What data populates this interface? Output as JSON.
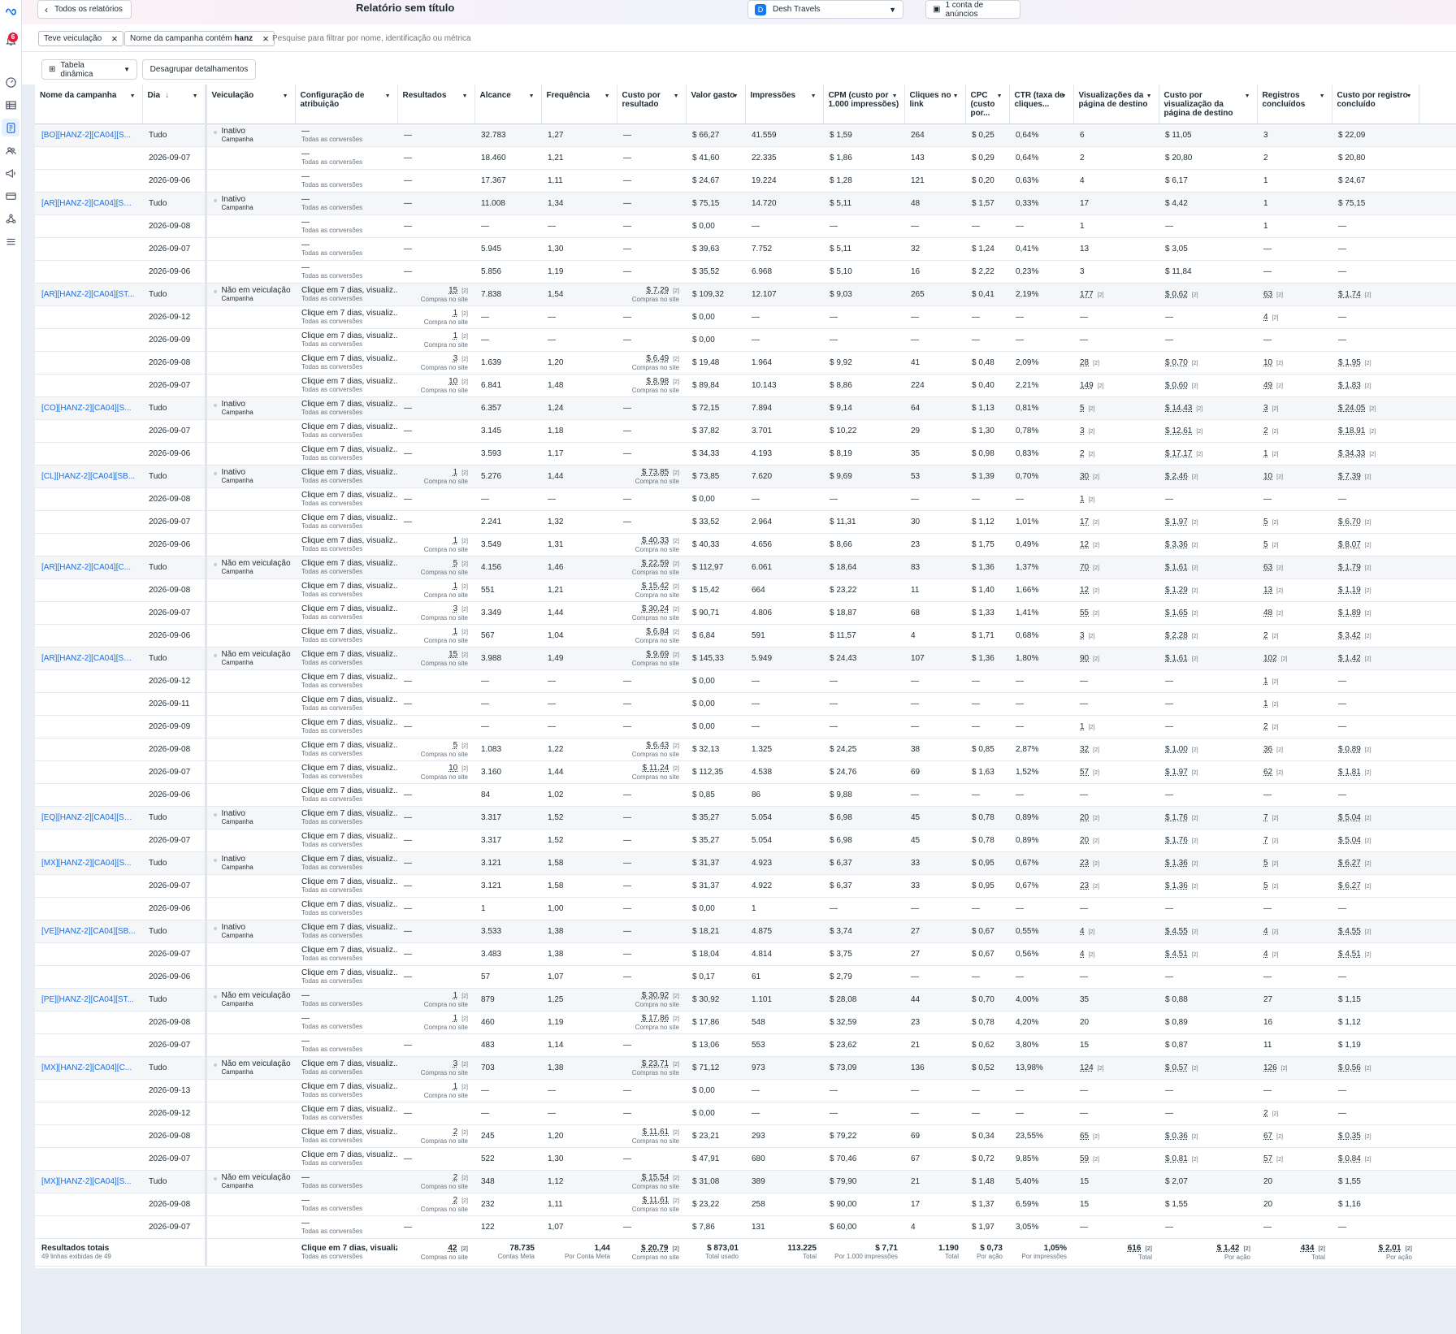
{
  "header": {
    "back_label": "Todos os relatórios",
    "title": "Relatório sem título",
    "account_initial": "D",
    "account_name": "Desh Travels",
    "ad_accounts": "1 conta de anúncios"
  },
  "notifications": {
    "count": "6"
  },
  "filters": {
    "chips": [
      "Teve veiculação",
      "Nome da campanha contém hanz"
    ],
    "placeholder": "Pesquise para filtrar por nome, identificação ou métrica"
  },
  "toolbar": {
    "pivot_label": "Tabela dinâmica",
    "ungroup_label": "Desagrupar detalhamentos"
  },
  "table": {
    "columns": [
      "Nome da campanha",
      "Dia",
      "Veiculação",
      "Configuração de atribuição",
      "Resultados",
      "Alcance",
      "Frequência",
      "Custo por resultado",
      "Valor gasto",
      "Impressões",
      "CPM (custo por 1.000 impressões)",
      "Cliques no link",
      "CPC (custo por...",
      "CTR (taxa de cliques...",
      "Visualizações da página de destino",
      "Custo por visualização da página de destino",
      "Registros concluídos",
      "Custo por registro concluído"
    ],
    "rows": [
      [
        "[BO][HANZ-2][CA04][S...",
        "Tudo",
        "Inativo|Campanha",
        "—|Todas as conversões",
        "—",
        "32.783",
        "1,27",
        "—",
        "$ 66,27",
        "41.559",
        "$ 1,59",
        "264",
        "$ 0,25",
        "0,64%",
        "6",
        "$ 11,05",
        "3",
        "$ 22,09"
      ],
      [
        "",
        "2026-09-07",
        "",
        "—|Todas as conversões",
        "—",
        "18.460",
        "1,21",
        "—",
        "$ 41,60",
        "22.335",
        "$ 1,86",
        "143",
        "$ 0,29",
        "0,64%",
        "2",
        "$ 20,80",
        "2",
        "$ 20,80"
      ],
      [
        "",
        "2026-09-06",
        "",
        "—|Todas as conversões",
        "—",
        "17.367",
        "1,11",
        "—",
        "$ 24,67",
        "19.224",
        "$ 1,28",
        "121",
        "$ 0,20",
        "0,63%",
        "4",
        "$ 6,17",
        "1",
        "$ 24,67"
      ],
      [
        "[AR][HANZ-2][CA04][SB...",
        "Tudo",
        "Inativo|Campanha",
        "—|Todas as conversões",
        "—",
        "11.008",
        "1,34",
        "—",
        "$ 75,15",
        "14.720",
        "$ 5,11",
        "48",
        "$ 1,57",
        "0,33%",
        "17",
        "$ 4,42",
        "1",
        "$ 75,15"
      ],
      [
        "",
        "2026-09-08",
        "",
        "—|Todas as conversões",
        "—",
        "—",
        "—",
        "—",
        "$ 0,00",
        "—",
        "—",
        "—",
        "—",
        "—",
        "1",
        "—",
        "1",
        "—"
      ],
      [
        "",
        "2026-09-07",
        "",
        "—|Todas as conversões",
        "—",
        "5.945",
        "1,30",
        "—",
        "$ 39,63",
        "7.752",
        "$ 5,11",
        "32",
        "$ 1,24",
        "0,41%",
        "13",
        "$ 3,05",
        "—",
        "—"
      ],
      [
        "",
        "2026-09-06",
        "",
        "—|Todas as conversões",
        "—",
        "5.856",
        "1,19",
        "—",
        "$ 35,52",
        "6.968",
        "$ 5,10",
        "16",
        "$ 2,22",
        "0,23%",
        "3",
        "$ 11,84",
        "—",
        "—"
      ],
      [
        "[AR][HANZ-2][CA04][ST...",
        "Tudo",
        "Não em veiculação|Campanha",
        "Clique em 7 dias, visualiz...|Todas as conversões",
        "15|Compras no site",
        "7.838",
        "1,54",
        "$ 7,29|Compras no site",
        "$ 109,32",
        "12.107",
        "$ 9,03",
        "265",
        "$ 0,41",
        "2,19%",
        "177",
        "$ 0,62",
        "63",
        "$ 1,74"
      ],
      [
        "",
        "2026-09-12",
        "",
        "Clique em 7 dias, visualiz...|Todas as conversões",
        "1|Compra no site",
        "—",
        "—",
        "—",
        "$ 0,00",
        "—",
        "—",
        "—",
        "—",
        "—",
        "—",
        "—",
        "4",
        "—"
      ],
      [
        "",
        "2026-09-09",
        "",
        "Clique em 7 dias, visualiz...|Todas as conversões",
        "1|Compra no site",
        "—",
        "—",
        "—",
        "$ 0,00",
        "—",
        "—",
        "—",
        "—",
        "—",
        "—",
        "—",
        "—",
        "—"
      ],
      [
        "",
        "2026-09-08",
        "",
        "Clique em 7 dias, visualiz...|Todas as conversões",
        "3|Compras no site",
        "1.639",
        "1,20",
        "$ 6,49|Compras no site",
        "$ 19,48",
        "1.964",
        "$ 9,92",
        "41",
        "$ 0,48",
        "2,09%",
        "28",
        "$ 0,70",
        "10",
        "$ 1,95"
      ],
      [
        "",
        "2026-09-07",
        "",
        "Clique em 7 dias, visualiz...|Todas as conversões",
        "10|Compras no site",
        "6.841",
        "1,48",
        "$ 8,98|Compras no site",
        "$ 89,84",
        "10.143",
        "$ 8,86",
        "224",
        "$ 0,40",
        "2,21%",
        "149",
        "$ 0,60",
        "49",
        "$ 1,83"
      ],
      [
        "[CO][HANZ-2][CA04][S...",
        "Tudo",
        "Inativo|Campanha",
        "Clique em 7 dias, visualiz...|Todas as conversões",
        "—",
        "6.357",
        "1,24",
        "—",
        "$ 72,15",
        "7.894",
        "$ 9,14",
        "64",
        "$ 1,13",
        "0,81%",
        "5",
        "$ 14,43",
        "3",
        "$ 24,05"
      ],
      [
        "",
        "2026-09-07",
        "",
        "Clique em 7 dias, visualiz...|Todas as conversões",
        "—",
        "3.145",
        "1,18",
        "—",
        "$ 37,82",
        "3.701",
        "$ 10,22",
        "29",
        "$ 1,30",
        "0,78%",
        "3",
        "$ 12,61",
        "2",
        "$ 18,91"
      ],
      [
        "",
        "2026-09-06",
        "",
        "Clique em 7 dias, visualiz...|Todas as conversões",
        "—",
        "3.593",
        "1,17",
        "—",
        "$ 34,33",
        "4.193",
        "$ 8,19",
        "35",
        "$ 0,98",
        "0,83%",
        "2",
        "$ 17,17",
        "1",
        "$ 34,33"
      ],
      [
        "[CL][HANZ-2][CA04][SB...",
        "Tudo",
        "Inativo|Campanha",
        "Clique em 7 dias, visualiz...|Todas as conversões",
        "1|Compra no site",
        "5.276",
        "1,44",
        "$ 73,85|Compra no site",
        "$ 73,85",
        "7.620",
        "$ 9,69",
        "53",
        "$ 1,39",
        "0,70%",
        "30",
        "$ 2,46",
        "10",
        "$ 7,39"
      ],
      [
        "",
        "2026-09-08",
        "",
        "Clique em 7 dias, visualiz...|Todas as conversões",
        "—",
        "—",
        "—",
        "—",
        "$ 0,00",
        "—",
        "—",
        "—",
        "—",
        "—",
        "1",
        "—",
        "—",
        "—"
      ],
      [
        "",
        "2026-09-07",
        "",
        "Clique em 7 dias, visualiz...|Todas as conversões",
        "—",
        "2.241",
        "1,32",
        "—",
        "$ 33,52",
        "2.964",
        "$ 11,31",
        "30",
        "$ 1,12",
        "1,01%",
        "17",
        "$ 1,97",
        "5",
        "$ 6,70"
      ],
      [
        "",
        "2026-09-06",
        "",
        "Clique em 7 dias, visualiz...|Todas as conversões",
        "1|Compra no site",
        "3.549",
        "1,31",
        "$ 40,33|Compra no site",
        "$ 40,33",
        "4.656",
        "$ 8,66",
        "23",
        "$ 1,75",
        "0,49%",
        "12",
        "$ 3,36",
        "5",
        "$ 8,07"
      ],
      [
        "[AR][HANZ-2][CA04][C...",
        "Tudo",
        "Não em veiculação|Campanha",
        "Clique em 7 dias, visualiz...|Todas as conversões",
        "5|Compras no site",
        "4.156",
        "1,46",
        "$ 22,59|Compras no site",
        "$ 112,97",
        "6.061",
        "$ 18,64",
        "83",
        "$ 1,36",
        "1,37%",
        "70",
        "$ 1,61",
        "63",
        "$ 1,79"
      ],
      [
        "",
        "2026-09-08",
        "",
        "Clique em 7 dias, visualiz...|Todas as conversões",
        "1|Compra no site",
        "551",
        "1,21",
        "$ 15,42|Compra no site",
        "$ 15,42",
        "664",
        "$ 23,22",
        "11",
        "$ 1,40",
        "1,66%",
        "12",
        "$ 1,29",
        "13",
        "$ 1,19"
      ],
      [
        "",
        "2026-09-07",
        "",
        "Clique em 7 dias, visualiz...|Todas as conversões",
        "3|Compras no site",
        "3.349",
        "1,44",
        "$ 30,24|Compras no site",
        "$ 90,71",
        "4.806",
        "$ 18,87",
        "68",
        "$ 1,33",
        "1,41%",
        "55",
        "$ 1,65",
        "48",
        "$ 1,89"
      ],
      [
        "",
        "2026-09-06",
        "",
        "Clique em 7 dias, visualiz...|Todas as conversões",
        "1|Compra no site",
        "567",
        "1,04",
        "$ 6,84|Compra no site",
        "$ 6,84",
        "591",
        "$ 11,57",
        "4",
        "$ 1,71",
        "0,68%",
        "3",
        "$ 2,28",
        "2",
        "$ 3,42"
      ],
      [
        "[AR][HANZ-2][CA04][SB...",
        "Tudo",
        "Não em veiculação|Campanha",
        "Clique em 7 dias, visualiz...|Todas as conversões",
        "15|Compras no site",
        "3.988",
        "1,49",
        "$ 9,69|Compras no site",
        "$ 145,33",
        "5.949",
        "$ 24,43",
        "107",
        "$ 1,36",
        "1,80%",
        "90",
        "$ 1,61",
        "102",
        "$ 1,42"
      ],
      [
        "",
        "2026-09-12",
        "",
        "Clique em 7 dias, visualiz...|Todas as conversões",
        "—",
        "—",
        "—",
        "—",
        "$ 0,00",
        "—",
        "—",
        "—",
        "—",
        "—",
        "—",
        "—",
        "1",
        "—"
      ],
      [
        "",
        "2026-09-11",
        "",
        "Clique em 7 dias, visualiz...|Todas as conversões",
        "—",
        "—",
        "—",
        "—",
        "$ 0,00",
        "—",
        "—",
        "—",
        "—",
        "—",
        "—",
        "—",
        "1",
        "—"
      ],
      [
        "",
        "2026-09-09",
        "",
        "Clique em 7 dias, visualiz...|Todas as conversões",
        "—",
        "—",
        "—",
        "—",
        "$ 0,00",
        "—",
        "—",
        "—",
        "—",
        "—",
        "1",
        "—",
        "2",
        "—"
      ],
      [
        "",
        "2026-09-08",
        "",
        "Clique em 7 dias, visualiz...|Todas as conversões",
        "5|Compras no site",
        "1.083",
        "1,22",
        "$ 6,43|Compras no site",
        "$ 32,13",
        "1.325",
        "$ 24,25",
        "38",
        "$ 0,85",
        "2,87%",
        "32",
        "$ 1,00",
        "36",
        "$ 0,89"
      ],
      [
        "",
        "2026-09-07",
        "",
        "Clique em 7 dias, visualiz...|Todas as conversões",
        "10|Compras no site",
        "3.160",
        "1,44",
        "$ 11,24|Compras no site",
        "$ 112,35",
        "4.538",
        "$ 24,76",
        "69",
        "$ 1,63",
        "1,52%",
        "57",
        "$ 1,97",
        "62",
        "$ 1,81"
      ],
      [
        "",
        "2026-09-06",
        "",
        "Clique em 7 dias, visualiz...|Todas as conversões",
        "—",
        "84",
        "1,02",
        "—",
        "$ 0,85",
        "86",
        "$ 9,88",
        "—",
        "—",
        "—",
        "—",
        "—",
        "—",
        "—"
      ],
      [
        "[EQ][HANZ-2][CA04][SB...",
        "Tudo",
        "Inativo|Campanha",
        "Clique em 7 dias, visualiz...|Todas as conversões",
        "—",
        "3.317",
        "1,52",
        "—",
        "$ 35,27",
        "5.054",
        "$ 6,98",
        "45",
        "$ 0,78",
        "0,89%",
        "20",
        "$ 1,76",
        "7",
        "$ 5,04"
      ],
      [
        "",
        "2026-09-07",
        "",
        "Clique em 7 dias, visualiz...|Todas as conversões",
        "—",
        "3.317",
        "1,52",
        "—",
        "$ 35,27",
        "5.054",
        "$ 6,98",
        "45",
        "$ 0,78",
        "0,89%",
        "20",
        "$ 1,76",
        "7",
        "$ 5,04"
      ],
      [
        "[MX][HANZ-2][CA04][S...",
        "Tudo",
        "Inativo|Campanha",
        "Clique em 7 dias, visualiz...|Todas as conversões",
        "—",
        "3.121",
        "1,58",
        "—",
        "$ 31,37",
        "4.923",
        "$ 6,37",
        "33",
        "$ 0,95",
        "0,67%",
        "23",
        "$ 1,36",
        "5",
        "$ 6,27"
      ],
      [
        "",
        "2026-09-07",
        "",
        "Clique em 7 dias, visualiz...|Todas as conversões",
        "—",
        "3.121",
        "1,58",
        "—",
        "$ 31,37",
        "4.922",
        "$ 6,37",
        "33",
        "$ 0,95",
        "0,67%",
        "23",
        "$ 1,36",
        "5",
        "$ 6,27"
      ],
      [
        "",
        "2026-09-06",
        "",
        "Clique em 7 dias, visualiz...|Todas as conversões",
        "—",
        "1",
        "1,00",
        "—",
        "$ 0,00",
        "1",
        "—",
        "—",
        "—",
        "—",
        "—",
        "—",
        "—",
        "—"
      ],
      [
        "[VE][HANZ-2][CA04][SB...",
        "Tudo",
        "Inativo|Campanha",
        "Clique em 7 dias, visualiz...|Todas as conversões",
        "—",
        "3.533",
        "1,38",
        "—",
        "$ 18,21",
        "4.875",
        "$ 3,74",
        "27",
        "$ 0,67",
        "0,55%",
        "4",
        "$ 4,55",
        "4",
        "$ 4,55"
      ],
      [
        "",
        "2026-09-07",
        "",
        "Clique em 7 dias, visualiz...|Todas as conversões",
        "—",
        "3.483",
        "1,38",
        "—",
        "$ 18,04",
        "4.814",
        "$ 3,75",
        "27",
        "$ 0,67",
        "0,56%",
        "4",
        "$ 4,51",
        "4",
        "$ 4,51"
      ],
      [
        "",
        "2026-09-06",
        "",
        "Clique em 7 dias, visualiz...|Todas as conversões",
        "—",
        "57",
        "1,07",
        "—",
        "$ 0,17",
        "61",
        "$ 2,79",
        "—",
        "—",
        "—",
        "—",
        "—",
        "—",
        "—"
      ],
      [
        "[PE][HANZ-2][CA04][ST...",
        "Tudo",
        "Não em veiculação|Campanha",
        "—|Todas as conversões",
        "1|Compra no site",
        "879",
        "1,25",
        "$ 30,92|Compra no site",
        "$ 30,92",
        "1.101",
        "$ 28,08",
        "44",
        "$ 0,70",
        "4,00%",
        "35",
        "$ 0,88",
        "27",
        "$ 1,15"
      ],
      [
        "",
        "2026-09-08",
        "",
        "—|Todas as conversões",
        "1|Compra no site",
        "460",
        "1,19",
        "$ 17,86|Compra no site",
        "$ 17,86",
        "548",
        "$ 32,59",
        "23",
        "$ 0,78",
        "4,20%",
        "20",
        "$ 0,89",
        "16",
        "$ 1,12"
      ],
      [
        "",
        "2026-09-07",
        "",
        "—|Todas as conversões",
        "—",
        "483",
        "1,14",
        "—",
        "$ 13,06",
        "553",
        "$ 23,62",
        "21",
        "$ 0,62",
        "3,80%",
        "15",
        "$ 0,87",
        "11",
        "$ 1,19"
      ],
      [
        "[MX][HANZ-2][CA04][C...",
        "Tudo",
        "Não em veiculação|Campanha",
        "Clique em 7 dias, visualiz...|Todas as conversões",
        "3|Compras no site",
        "703",
        "1,38",
        "$ 23,71|Compras no site",
        "$ 71,12",
        "973",
        "$ 73,09",
        "136",
        "$ 0,52",
        "13,98%",
        "124",
        "$ 0,57",
        "126",
        "$ 0,56"
      ],
      [
        "",
        "2026-09-13",
        "",
        "Clique em 7 dias, visualiz...|Todas as conversões",
        "1|Compra no site",
        "—",
        "—",
        "—",
        "$ 0,00",
        "—",
        "—",
        "—",
        "—",
        "—",
        "—",
        "—",
        "—",
        "—"
      ],
      [
        "",
        "2026-09-12",
        "",
        "Clique em 7 dias, visualiz...|Todas as conversões",
        "—",
        "—",
        "—",
        "—",
        "$ 0,00",
        "—",
        "—",
        "—",
        "—",
        "—",
        "—",
        "—",
        "2",
        "—"
      ],
      [
        "",
        "2026-09-08",
        "",
        "Clique em 7 dias, visualiz...|Todas as conversões",
        "2|Compras no site",
        "245",
        "1,20",
        "$ 11,61|Compras no site",
        "$ 23,21",
        "293",
        "$ 79,22",
        "69",
        "$ 0,34",
        "23,55%",
        "65",
        "$ 0,36",
        "67",
        "$ 0,35"
      ],
      [
        "",
        "2026-09-07",
        "",
        "Clique em 7 dias, visualiz...|Todas as conversões",
        "—",
        "522",
        "1,30",
        "—",
        "$ 47,91",
        "680",
        "$ 70,46",
        "67",
        "$ 0,72",
        "9,85%",
        "59",
        "$ 0,81",
        "57",
        "$ 0,84"
      ],
      [
        "[MX][HANZ-2][CA04][S...",
        "Tudo",
        "Não em veiculação|Campanha",
        "—|Todas as conversões",
        "2|Compras no site",
        "348",
        "1,12",
        "$ 15,54|Compras no site",
        "$ 31,08",
        "389",
        "$ 79,90",
        "21",
        "$ 1,48",
        "5,40%",
        "15",
        "$ 2,07",
        "20",
        "$ 1,55"
      ],
      [
        "",
        "2026-09-08",
        "",
        "—|Todas as conversões",
        "2|Compras no site",
        "232",
        "1,11",
        "$ 11,61|Compras no site",
        "$ 23,22",
        "258",
        "$ 90,00",
        "17",
        "$ 1,37",
        "6,59%",
        "15",
        "$ 1,55",
        "20",
        "$ 1,16"
      ],
      [
        "",
        "2026-09-07",
        "",
        "—|Todas as conversões",
        "—",
        "122",
        "1,07",
        "—",
        "$ 7,86",
        "131",
        "$ 60,00",
        "4",
        "$ 1,97",
        "3,05%",
        "—",
        "—",
        "—",
        "—"
      ]
    ],
    "footer": {
      "label": "Resultados totais",
      "sublabel": "49 linhas exibidas de 49",
      "cells": [
        "Clique em 7 dias, visualiz...|Todas as conversões",
        "42|Compras no site",
        "78.735|Contas Meta",
        "1,44|Por Conta Meta",
        "$ 20,79|Compras no site",
        "$ 873,01|Total usado",
        "113.225|Total",
        "$ 7,71|Por 1.000 impressões",
        "1.190|Total",
        "$ 0,73|Por ação",
        "1,05%|Por impressões",
        "616|Total",
        "$ 1,42|Por ação",
        "434|Total",
        "$ 2,01|Por ação"
      ]
    }
  }
}
